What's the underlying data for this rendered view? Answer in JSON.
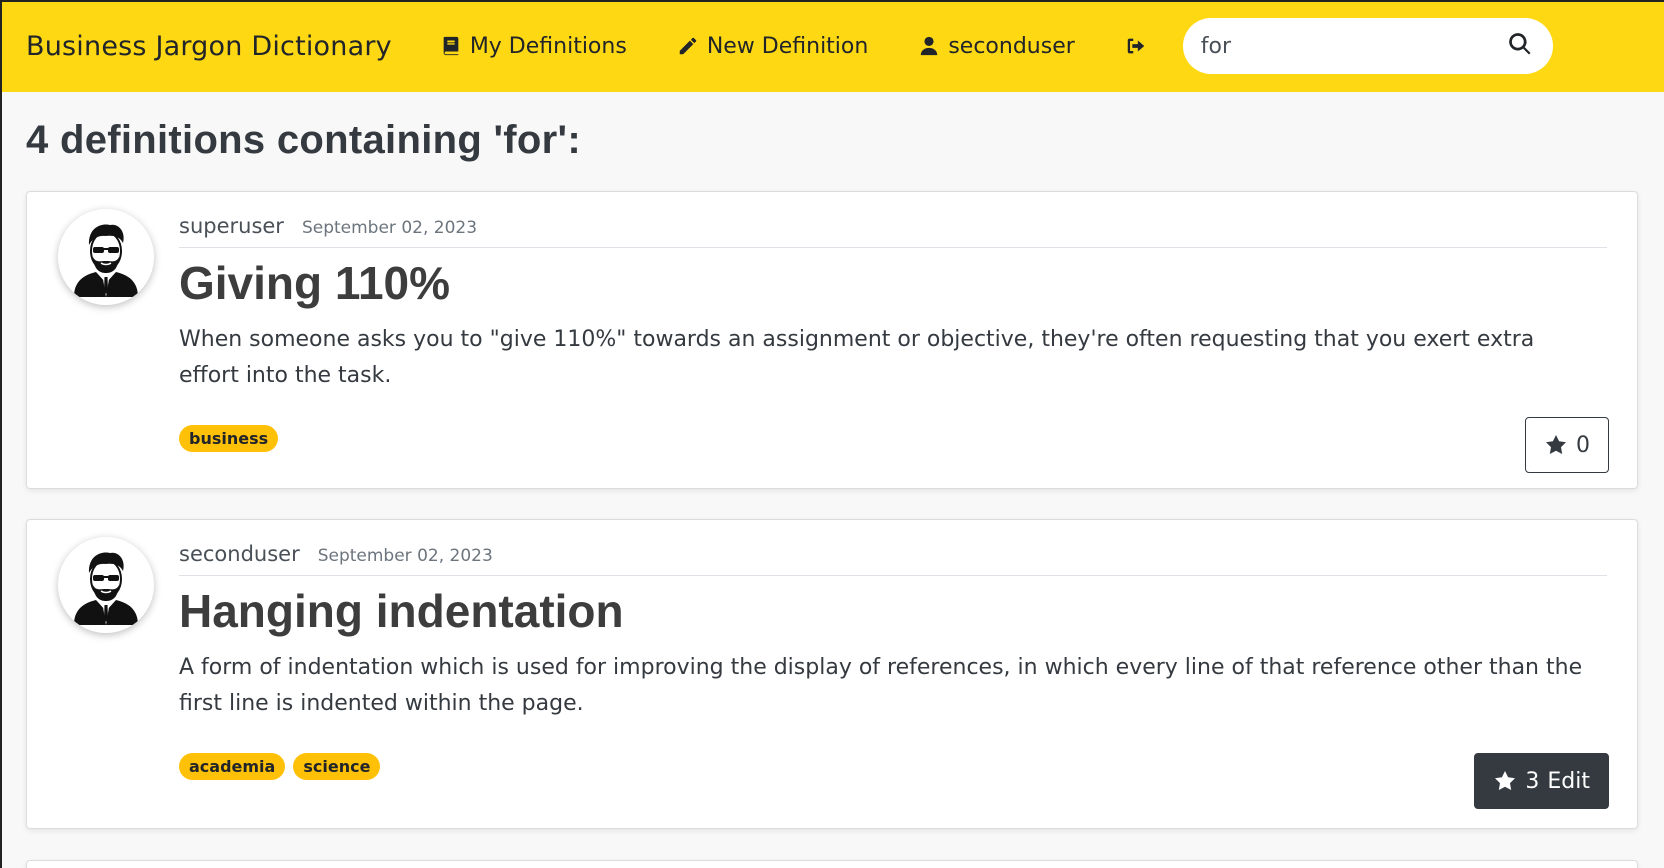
{
  "navbar": {
    "brand": "Business Jargon Dictionary",
    "links": [
      {
        "label": "My Definitions",
        "icon": "book-icon"
      },
      {
        "label": "New Definition",
        "icon": "pencil-icon"
      },
      {
        "label": "seconduser",
        "icon": "user-icon"
      }
    ],
    "logout_icon": "sign-out-icon",
    "search": {
      "value": "for",
      "icon": "search-icon"
    },
    "background_color": "#ffd814"
  },
  "results": {
    "heading": "4 definitions containing 'for':"
  },
  "definitions": [
    {
      "author": "superuser",
      "date": "September 02, 2023",
      "title": "Giving 110%",
      "text": "When someone asks you to \"give 110%\" towards an assignment or objective, they're often requesting that you exert extra effort into the task.",
      "tags": [
        "business"
      ],
      "votes": "0",
      "action": ""
    },
    {
      "author": "seconduser",
      "date": "September 02, 2023",
      "title": "Hanging indentation",
      "text": "A form of indentation which is used for improving the display of references, in which every line of that reference other than the first line is indented within the page.",
      "tags": [
        "academia",
        "science"
      ],
      "votes": "3",
      "action": "Edit"
    }
  ],
  "colors": {
    "tag": "#ffc107",
    "dark_button": "#343a40"
  }
}
